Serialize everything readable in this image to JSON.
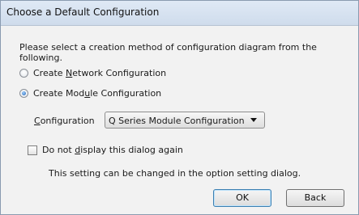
{
  "window": {
    "title": "Choose a Default Configuration"
  },
  "intro_text": "Please select a creation method of configuration diagram from the following.",
  "options": {
    "network": {
      "label_pre": "Create ",
      "label_key": "N",
      "label_post": "etwork Configuration",
      "checked": false
    },
    "module": {
      "label_pre": "Create Mod",
      "label_key": "u",
      "label_post": "le Configuration",
      "checked": true
    }
  },
  "configuration": {
    "label_key": "C",
    "label_post": "onfiguration",
    "selected_value": "Q Series Module Configuration"
  },
  "dont_show": {
    "label_pre": "Do not ",
    "label_key": "d",
    "label_post": "isplay this dialog again",
    "checked": false
  },
  "hint_text": "This setting can be changed in the option setting dialog.",
  "buttons": {
    "ok": "OK",
    "back": "Back"
  }
}
